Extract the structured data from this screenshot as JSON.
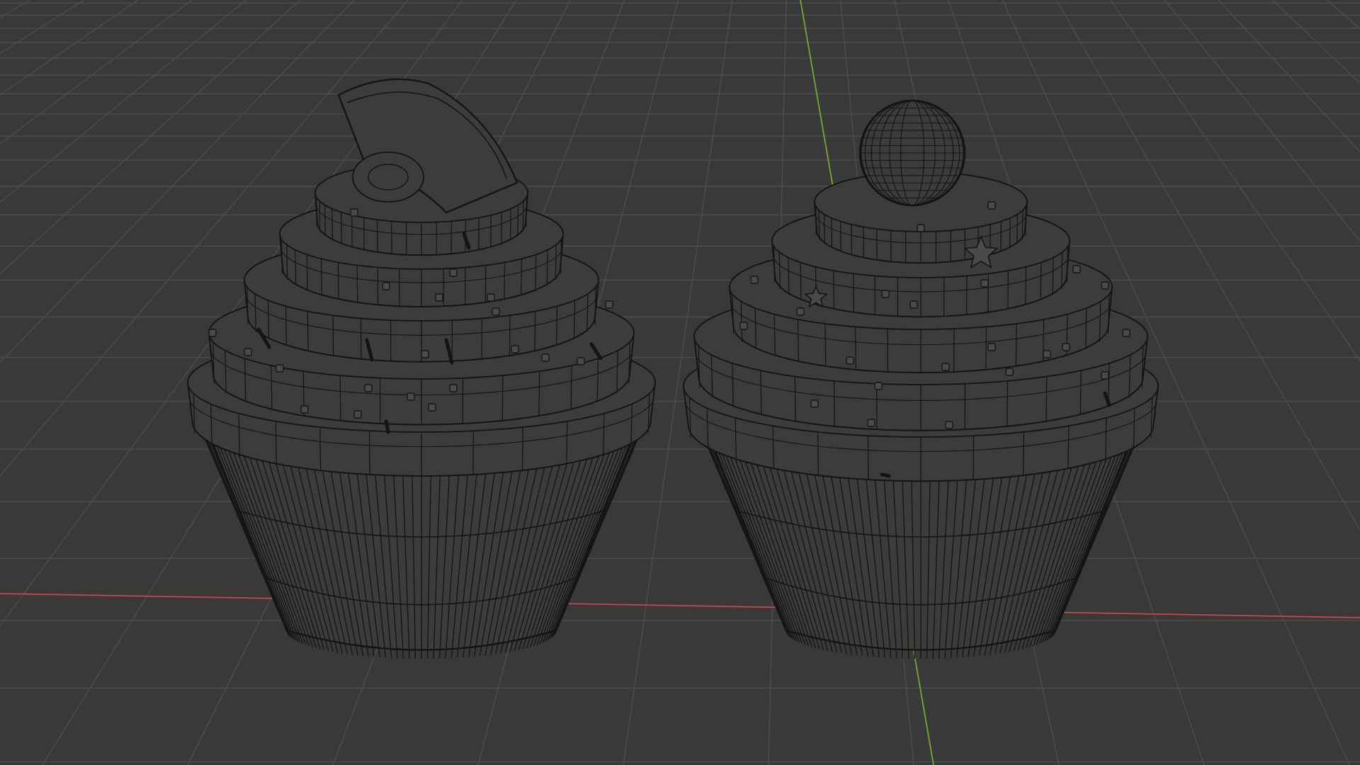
{
  "viewport": {
    "mode": "wireframe",
    "background_color": "#393939",
    "grid_color": "#4d4d4d",
    "axis_x_color": "#c64758",
    "axis_y_color": "#7aa72f",
    "wire_color": "#141414",
    "mesh_fill_color": "#3c3c3c"
  },
  "scene": {
    "objects": [
      {
        "name": "cupcake-left",
        "topping": "orange-slice"
      },
      {
        "name": "cupcake-right",
        "topping": "sphere-with-star-sprinkles"
      }
    ]
  }
}
